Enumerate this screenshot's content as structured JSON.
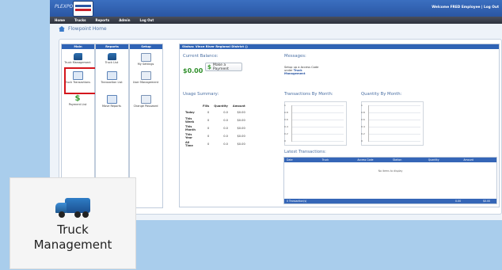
{
  "app": {
    "brand": "PLEXPORT",
    "welcome": "Welcome FRED Employee | Log Out",
    "nav": [
      "Home",
      "Trucks",
      "Reports",
      "Admin",
      "Log Out"
    ],
    "title": "Flowpoint Home"
  },
  "columns": {
    "main": {
      "header": "Main",
      "tiles": [
        "Truck Management",
        "Truck Transactions",
        "Payment List"
      ]
    },
    "reports": {
      "header": "Reports",
      "tiles": [
        "Truck List",
        "Transaction List",
        "Move Reports"
      ]
    },
    "setup": {
      "header": "Setup",
      "tiles": [
        "My Settings",
        "User Management",
        "Change Password"
      ]
    }
  },
  "status": {
    "header": "Status: Vince River Regional District ()",
    "balance_label": "Current Balance:",
    "balance_value": "$0.00",
    "payment_button": "Make a Payment",
    "messages_label": "Messages:",
    "messages_text": "Setup up a Access Code under",
    "messages_link": "Truck Management",
    "usage_label": "Usage Summary:",
    "usage_headers": [
      "Fills",
      "Quantity",
      "Amount"
    ],
    "usage_rows": [
      {
        "label": "Today",
        "fills": "0",
        "qty": "0.0",
        "amt": "$0.00"
      },
      {
        "label": "This Week",
        "fills": "0",
        "qty": "0.0",
        "amt": "$0.00"
      },
      {
        "label": "This Month",
        "fills": "0",
        "qty": "0.0",
        "amt": "$0.00"
      },
      {
        "label": "This Year",
        "fills": "0",
        "qty": "0.0",
        "amt": "$0.00"
      },
      {
        "label": "All Time",
        "fills": "0",
        "qty": "0.0",
        "amt": "$0.00"
      }
    ],
    "trans_month_label": "Transactions By Month:",
    "qty_month_label": "Quantity By Month:",
    "graph_ticks": [
      "1",
      "0.8",
      "0.6",
      "0.4",
      "0.2",
      "0"
    ],
    "latest_label": "Latest Transactions:",
    "latest_headers": [
      "Date",
      "Truck",
      "Access Code",
      "Station",
      "Quantity",
      "Amount"
    ],
    "no_items": "No items to display",
    "footer_count": "0 Transaction(s)",
    "footer_qty": "0.00",
    "footer_amt": "$0.00"
  },
  "zoom": {
    "label_line1": "Truck",
    "label_line2": "Management"
  }
}
